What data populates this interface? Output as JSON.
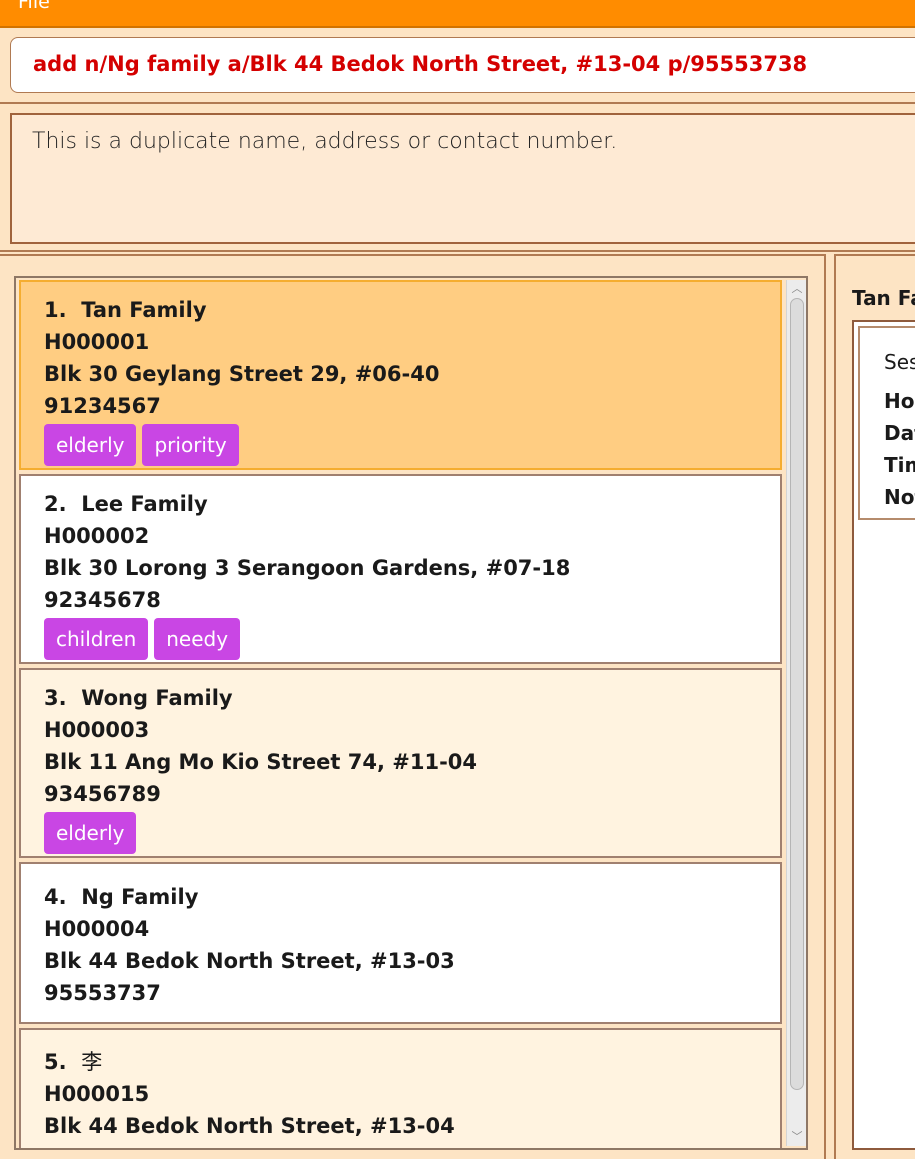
{
  "menu": {
    "file_label": "File"
  },
  "command": {
    "value": "add n/Ng family a/Blk 44 Bedok North Street, #13-04 p/95553738"
  },
  "result": {
    "message": "This is a duplicate name, address or contact number."
  },
  "households": [
    {
      "index": "1.",
      "name": "Tan Family",
      "id": "H000001",
      "address": "Blk 30 Geylang Street 29, #06-40",
      "phone": "91234567",
      "tags": [
        "elderly",
        "priority"
      ]
    },
    {
      "index": "2.",
      "name": "Lee Family",
      "id": "H000002",
      "address": "Blk 30 Lorong 3 Serangoon Gardens, #07-18",
      "phone": "92345678",
      "tags": [
        "children",
        "needy"
      ]
    },
    {
      "index": "3.",
      "name": "Wong Family",
      "id": "H000003",
      "address": "Blk 11 Ang Mo Kio Street 74, #11-04",
      "phone": "93456789",
      "tags": [
        "elderly"
      ]
    },
    {
      "index": "4.",
      "name": "Ng Family",
      "id": "H000004",
      "address": "Blk 44 Bedok North Street, #13-03",
      "phone": "95553737",
      "tags": []
    },
    {
      "index": "5.",
      "name": "李",
      "id": "H000015",
      "address": "Blk 44 Bedok North Street, #13-04",
      "phone": "",
      "tags": []
    }
  ],
  "detail": {
    "title": "Tan Fa",
    "session_lines": [
      "Sess",
      "Hou",
      "Dat",
      "Tim",
      "Not"
    ]
  },
  "colors": {
    "menubar": "#ff8c00",
    "command_text": "#d40000",
    "tag": "#c946e4",
    "selected_card": "#ffcd82"
  }
}
